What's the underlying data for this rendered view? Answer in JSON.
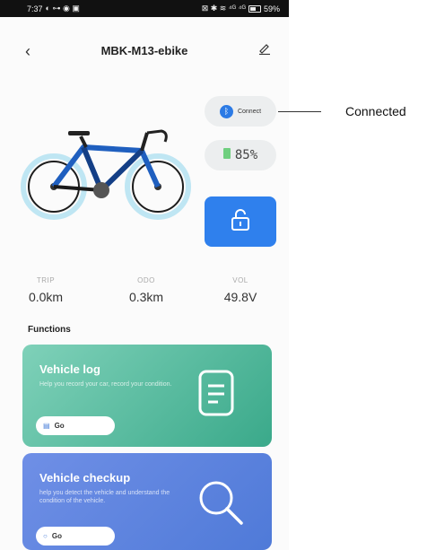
{
  "status_bar": {
    "time": "7:37",
    "left_icons": "◐ ⊶ ◉ ▣",
    "right_icons": "⊠ ✱ ≋ ⁴ᴳ ⁴ᴳ",
    "battery": "59%"
  },
  "header": {
    "title": "MBK-M13-ebike"
  },
  "device": {
    "connect_label": "Connect",
    "battery_level": "85%"
  },
  "callout": {
    "text": "Connected"
  },
  "stats": [
    {
      "label": "TRIP",
      "value": "0.0km"
    },
    {
      "label": "ODO",
      "value": "0.3km"
    },
    {
      "label": "VOL",
      "value": "49.8V"
    }
  ],
  "functions": {
    "heading": "Functions",
    "cards": [
      {
        "title": "Vehicle log",
        "description": "Help you record your car, record your condition.",
        "go_label": "Go"
      },
      {
        "title": "Vehicle checkup",
        "description": "help you detect the vehicle and understand the condition of the vehicle.",
        "go_label": "Go"
      }
    ]
  },
  "colors": {
    "accent": "#2f80ed",
    "log_card": "#4fb89a",
    "checkup_card": "#5b82de",
    "bike_blue": "#1f5fbf"
  }
}
